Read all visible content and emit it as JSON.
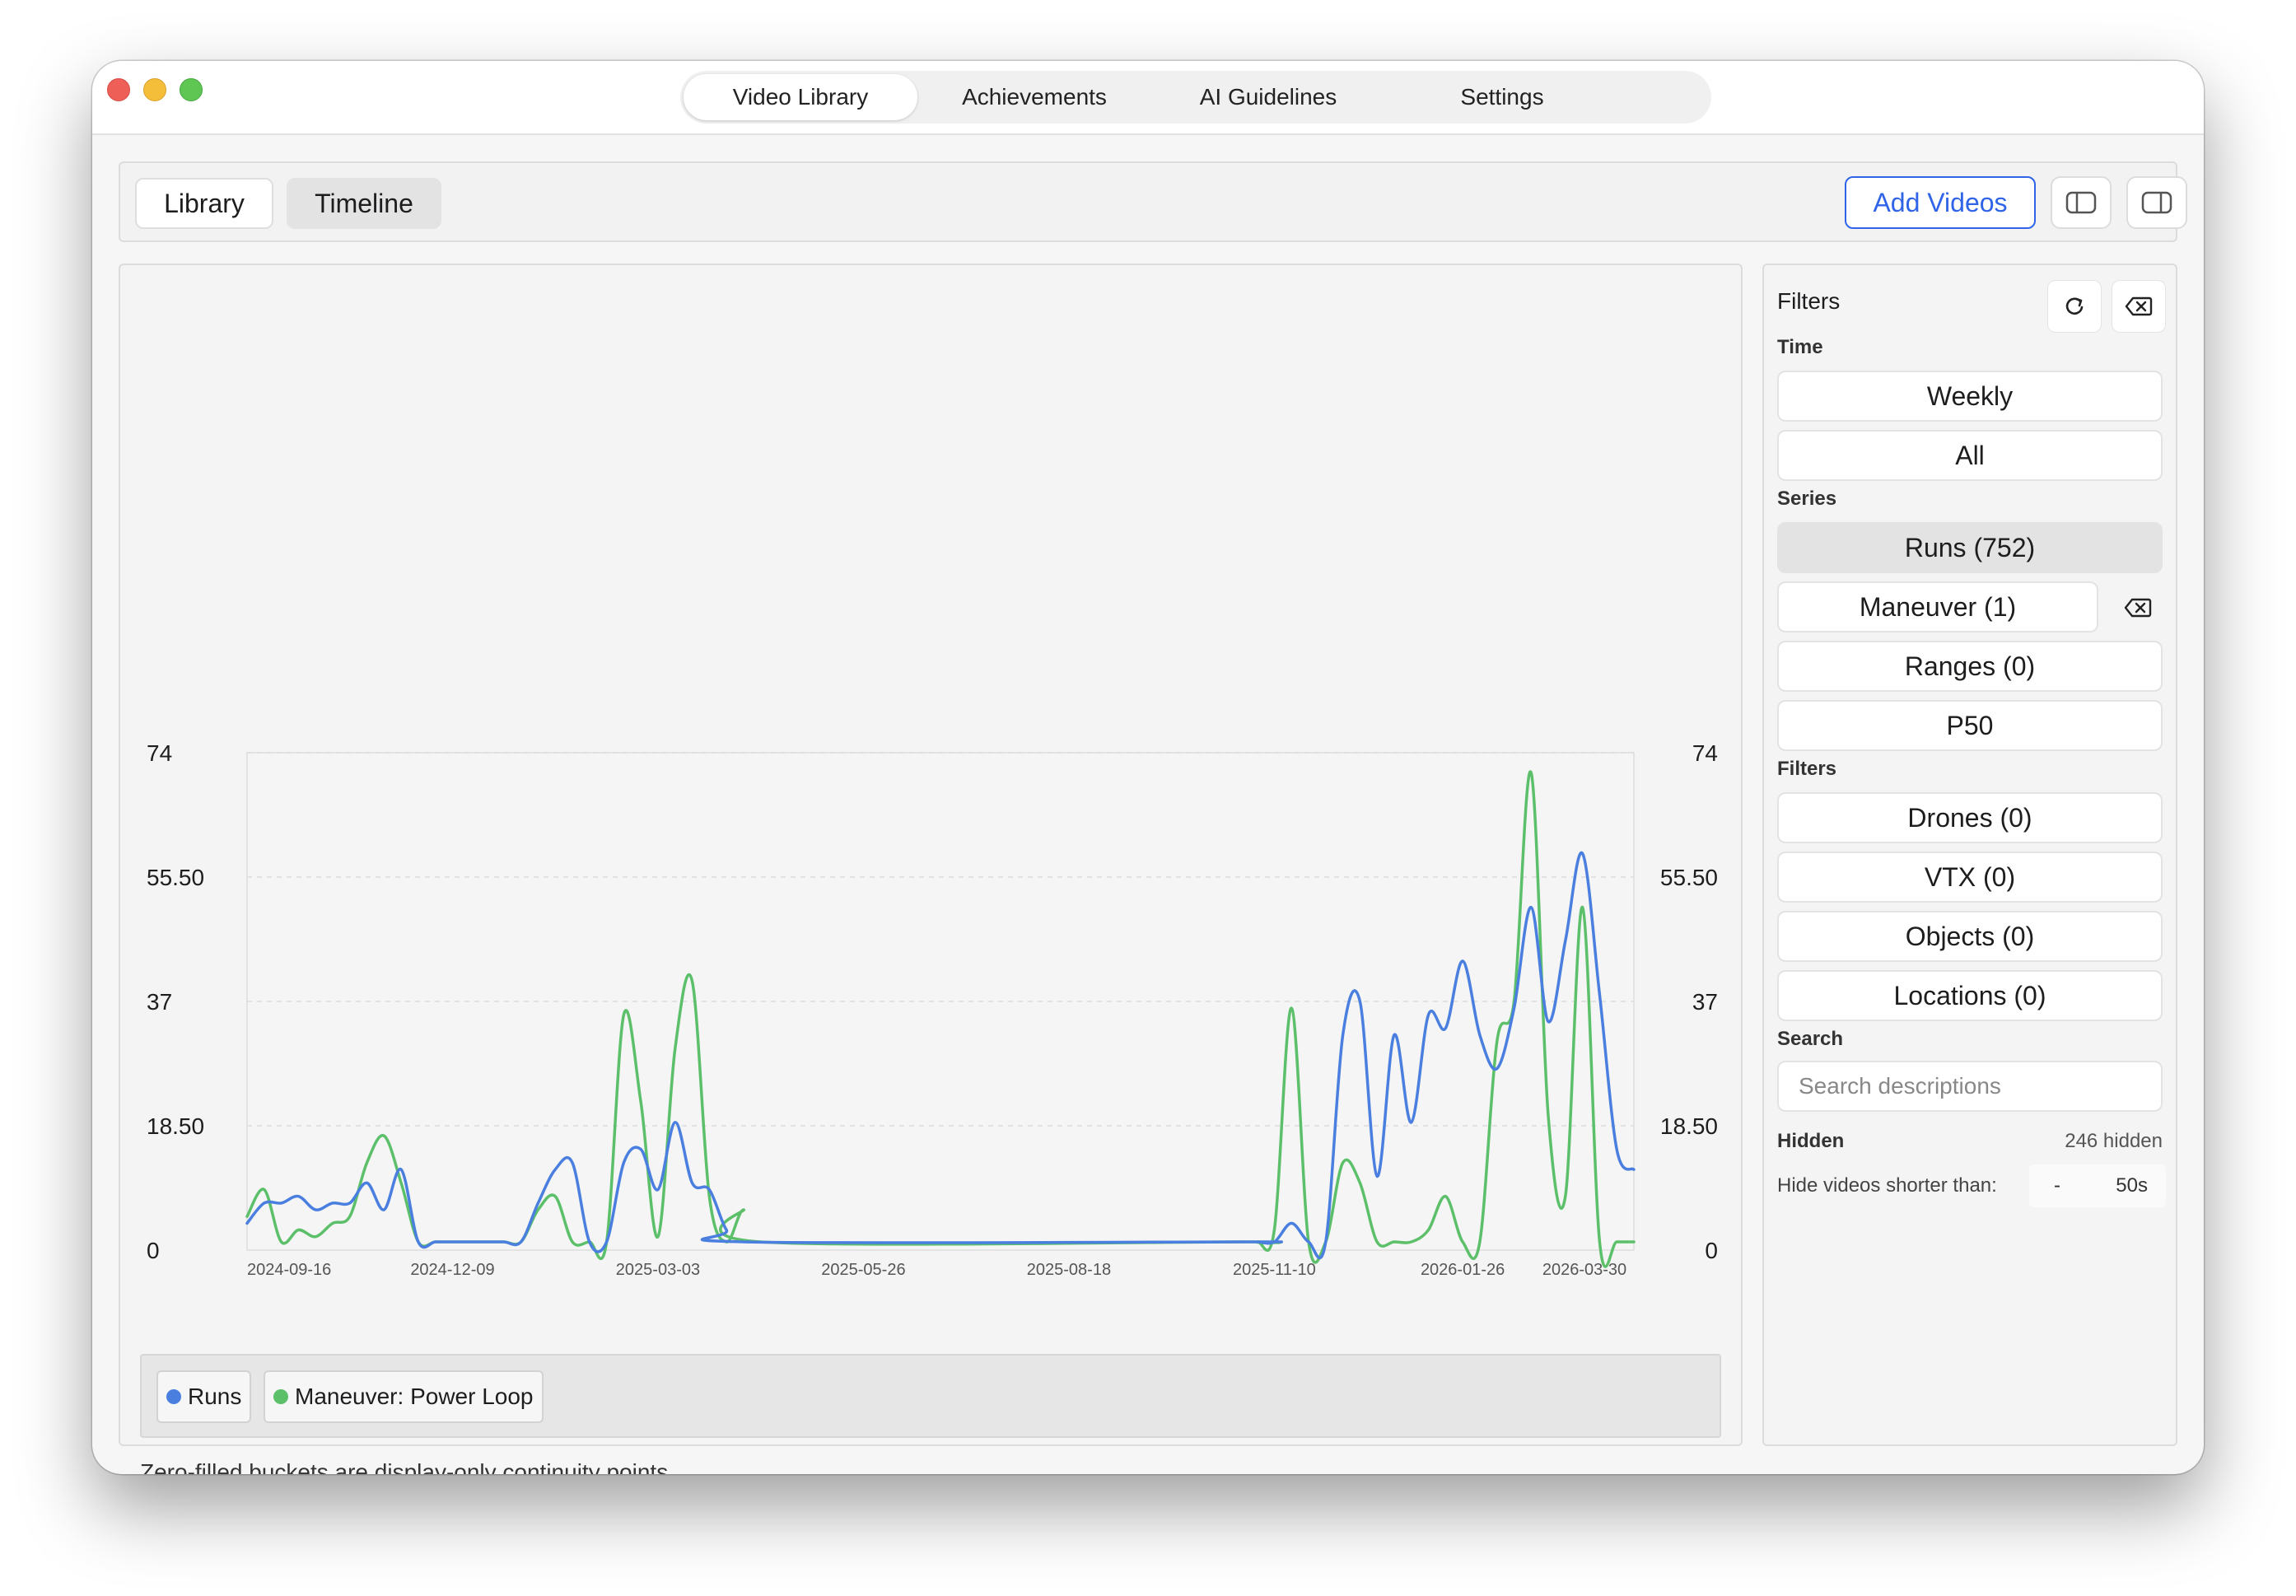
{
  "window": {
    "main_tabs": [
      {
        "label": "Video Library",
        "active": true
      },
      {
        "label": "Achievements",
        "active": false
      },
      {
        "label": "AI Guidelines",
        "active": false
      },
      {
        "label": "Settings",
        "active": false
      }
    ]
  },
  "toolbar": {
    "view_modes": [
      "Library",
      "Timeline"
    ],
    "active_view": "Timeline",
    "add_videos_label": "Add Videos",
    "left_sidebar_icon": "sidebar-left-icon",
    "right_sidebar_icon": "sidebar-right-icon"
  },
  "chart_data": {
    "type": "line",
    "y_ticks": [
      "0",
      "18.50",
      "37",
      "55.50",
      "74"
    ],
    "ylim": [
      0,
      74
    ],
    "x_ticks": [
      "2024-09-16",
      "2024-12-09",
      "2025-03-03",
      "2025-05-26",
      "2025-08-18",
      "2025-11-10",
      "2026-01-26",
      "2026-03-30"
    ],
    "grid": true,
    "legend_placement": "bottom",
    "series": [
      {
        "name": "Runs",
        "color": "#4a7fe0",
        "points": [
          [
            "2024-09-16",
            4
          ],
          [
            "2024-09-23",
            7
          ],
          [
            "2024-09-30",
            7
          ],
          [
            "2024-10-07",
            8
          ],
          [
            "2024-10-14",
            6
          ],
          [
            "2024-10-21",
            7
          ],
          [
            "2024-10-28",
            7
          ],
          [
            "2024-11-04",
            10
          ],
          [
            "2024-11-11",
            6
          ],
          [
            "2024-11-18",
            12
          ],
          [
            "2024-11-25",
            0
          ],
          [
            "2024-12-02",
            0
          ],
          [
            "2024-12-09",
            0
          ],
          [
            "2024-12-16",
            0
          ],
          [
            "2024-12-23",
            0
          ],
          [
            "2024-12-30",
            0
          ],
          [
            "2025-01-06",
            0
          ],
          [
            "2025-01-13",
            7
          ],
          [
            "2025-01-20",
            12
          ],
          [
            "2025-01-27",
            13
          ],
          [
            "2025-02-03",
            0
          ],
          [
            "2025-02-10",
            0
          ],
          [
            "2025-02-17",
            13
          ],
          [
            "2025-02-24",
            15
          ],
          [
            "2025-03-03",
            9
          ],
          [
            "2025-03-10",
            19
          ],
          [
            "2025-03-17",
            10
          ],
          [
            "2025-03-24",
            9
          ],
          [
            "2025-03-31",
            3
          ],
          [
            "2025-04-07",
            0
          ],
          [
            "2025-10-27",
            0
          ],
          [
            "2025-11-03",
            0
          ],
          [
            "2025-11-10",
            0
          ],
          [
            "2025-11-17",
            4
          ],
          [
            "2025-11-24",
            0
          ],
          [
            "2025-12-01",
            0
          ],
          [
            "2025-12-08",
            32
          ],
          [
            "2025-12-15",
            37
          ],
          [
            "2025-12-22",
            11
          ],
          [
            "2025-12-29",
            32
          ],
          [
            "2026-01-05",
            19
          ],
          [
            "2026-01-12",
            35
          ],
          [
            "2026-01-19",
            33
          ],
          [
            "2026-01-26",
            43
          ],
          [
            "2026-02-02",
            32
          ],
          [
            "2026-02-09",
            27
          ],
          [
            "2026-02-16",
            36
          ],
          [
            "2026-02-23",
            51
          ],
          [
            "2026-03-02",
            34
          ],
          [
            "2026-03-09",
            46
          ],
          [
            "2026-03-16",
            59
          ],
          [
            "2026-03-23",
            38
          ],
          [
            "2026-03-30",
            15
          ],
          [
            "2026-04-06",
            12
          ]
        ]
      },
      {
        "name": "Maneuver: Power Loop",
        "color": "#5cbf6a",
        "points": [
          [
            "2024-09-16",
            5
          ],
          [
            "2024-09-23",
            9
          ],
          [
            "2024-09-30",
            1
          ],
          [
            "2024-10-07",
            3
          ],
          [
            "2024-10-14",
            2
          ],
          [
            "2024-10-21",
            4
          ],
          [
            "2024-10-28",
            5
          ],
          [
            "2024-11-04",
            13
          ],
          [
            "2024-11-11",
            17
          ],
          [
            "2024-11-18",
            10
          ],
          [
            "2024-11-25",
            0
          ],
          [
            "2024-12-02",
            0
          ],
          [
            "2024-12-09",
            0
          ],
          [
            "2024-12-16",
            0
          ],
          [
            "2024-12-23",
            0
          ],
          [
            "2024-12-30",
            0
          ],
          [
            "2025-01-06",
            0
          ],
          [
            "2025-01-13",
            6
          ],
          [
            "2025-01-20",
            8
          ],
          [
            "2025-01-27",
            0
          ],
          [
            "2025-02-03",
            0
          ],
          [
            "2025-02-10",
            0
          ],
          [
            "2025-02-17",
            35
          ],
          [
            "2025-02-24",
            22
          ],
          [
            "2025-03-03",
            2
          ],
          [
            "2025-03-10",
            30
          ],
          [
            "2025-03-17",
            40
          ],
          [
            "2025-03-24",
            8
          ],
          [
            "2025-03-31",
            0
          ],
          [
            "2025-04-07",
            6
          ],
          [
            "2025-04-14",
            0
          ],
          [
            "2025-10-27",
            0
          ],
          [
            "2025-11-03",
            0
          ],
          [
            "2025-11-10",
            3
          ],
          [
            "2025-11-17",
            36
          ],
          [
            "2025-11-24",
            0
          ],
          [
            "2025-12-01",
            0
          ],
          [
            "2025-12-08",
            13
          ],
          [
            "2025-12-15",
            10
          ],
          [
            "2025-12-22",
            0
          ],
          [
            "2025-12-29",
            0
          ],
          [
            "2026-01-05",
            0
          ],
          [
            "2026-01-12",
            3
          ],
          [
            "2026-01-19",
            8
          ],
          [
            "2026-01-26",
            0
          ],
          [
            "2026-02-02",
            0
          ],
          [
            "2026-02-09",
            31
          ],
          [
            "2026-02-16",
            37
          ],
          [
            "2026-02-23",
            71
          ],
          [
            "2026-03-02",
            20
          ],
          [
            "2026-03-09",
            8
          ],
          [
            "2026-03-16",
            51
          ],
          [
            "2026-03-23",
            0
          ],
          [
            "2026-03-30",
            0
          ],
          [
            "2026-04-06",
            1
          ]
        ]
      }
    ]
  },
  "legend": [
    {
      "label": "Runs",
      "color": "#4a7fe0"
    },
    {
      "label": "Maneuver: Power Loop",
      "color": "#5cbf6a"
    }
  ],
  "footnote": "Zero-filled buckets are display-only continuity points.",
  "filters": {
    "title": "Filters",
    "refresh_icon": "refresh-icon",
    "clear_icon": "clear-delete-icon",
    "time_label": "Time",
    "time_options": [
      "Weekly",
      "All"
    ],
    "series_label": "Series",
    "series_options": [
      {
        "label": "Runs (752)",
        "selected": true
      },
      {
        "label": "Maneuver (1)",
        "selected": false,
        "removable": true
      },
      {
        "label": "Ranges (0)",
        "selected": false
      },
      {
        "label": "P50",
        "selected": false
      }
    ],
    "filters_label": "Filters",
    "filter_options": [
      "Drones (0)",
      "VTX (0)",
      "Objects (0)",
      "Locations (0)"
    ],
    "search_label": "Search",
    "search_placeholder": "Search descriptions",
    "search_value": "",
    "hidden_label": "Hidden",
    "hidden_count": "246 hidden",
    "hide_shorter_label": "Hide videos shorter than:",
    "stepper_minus": "-",
    "stepper_value": "50s"
  }
}
